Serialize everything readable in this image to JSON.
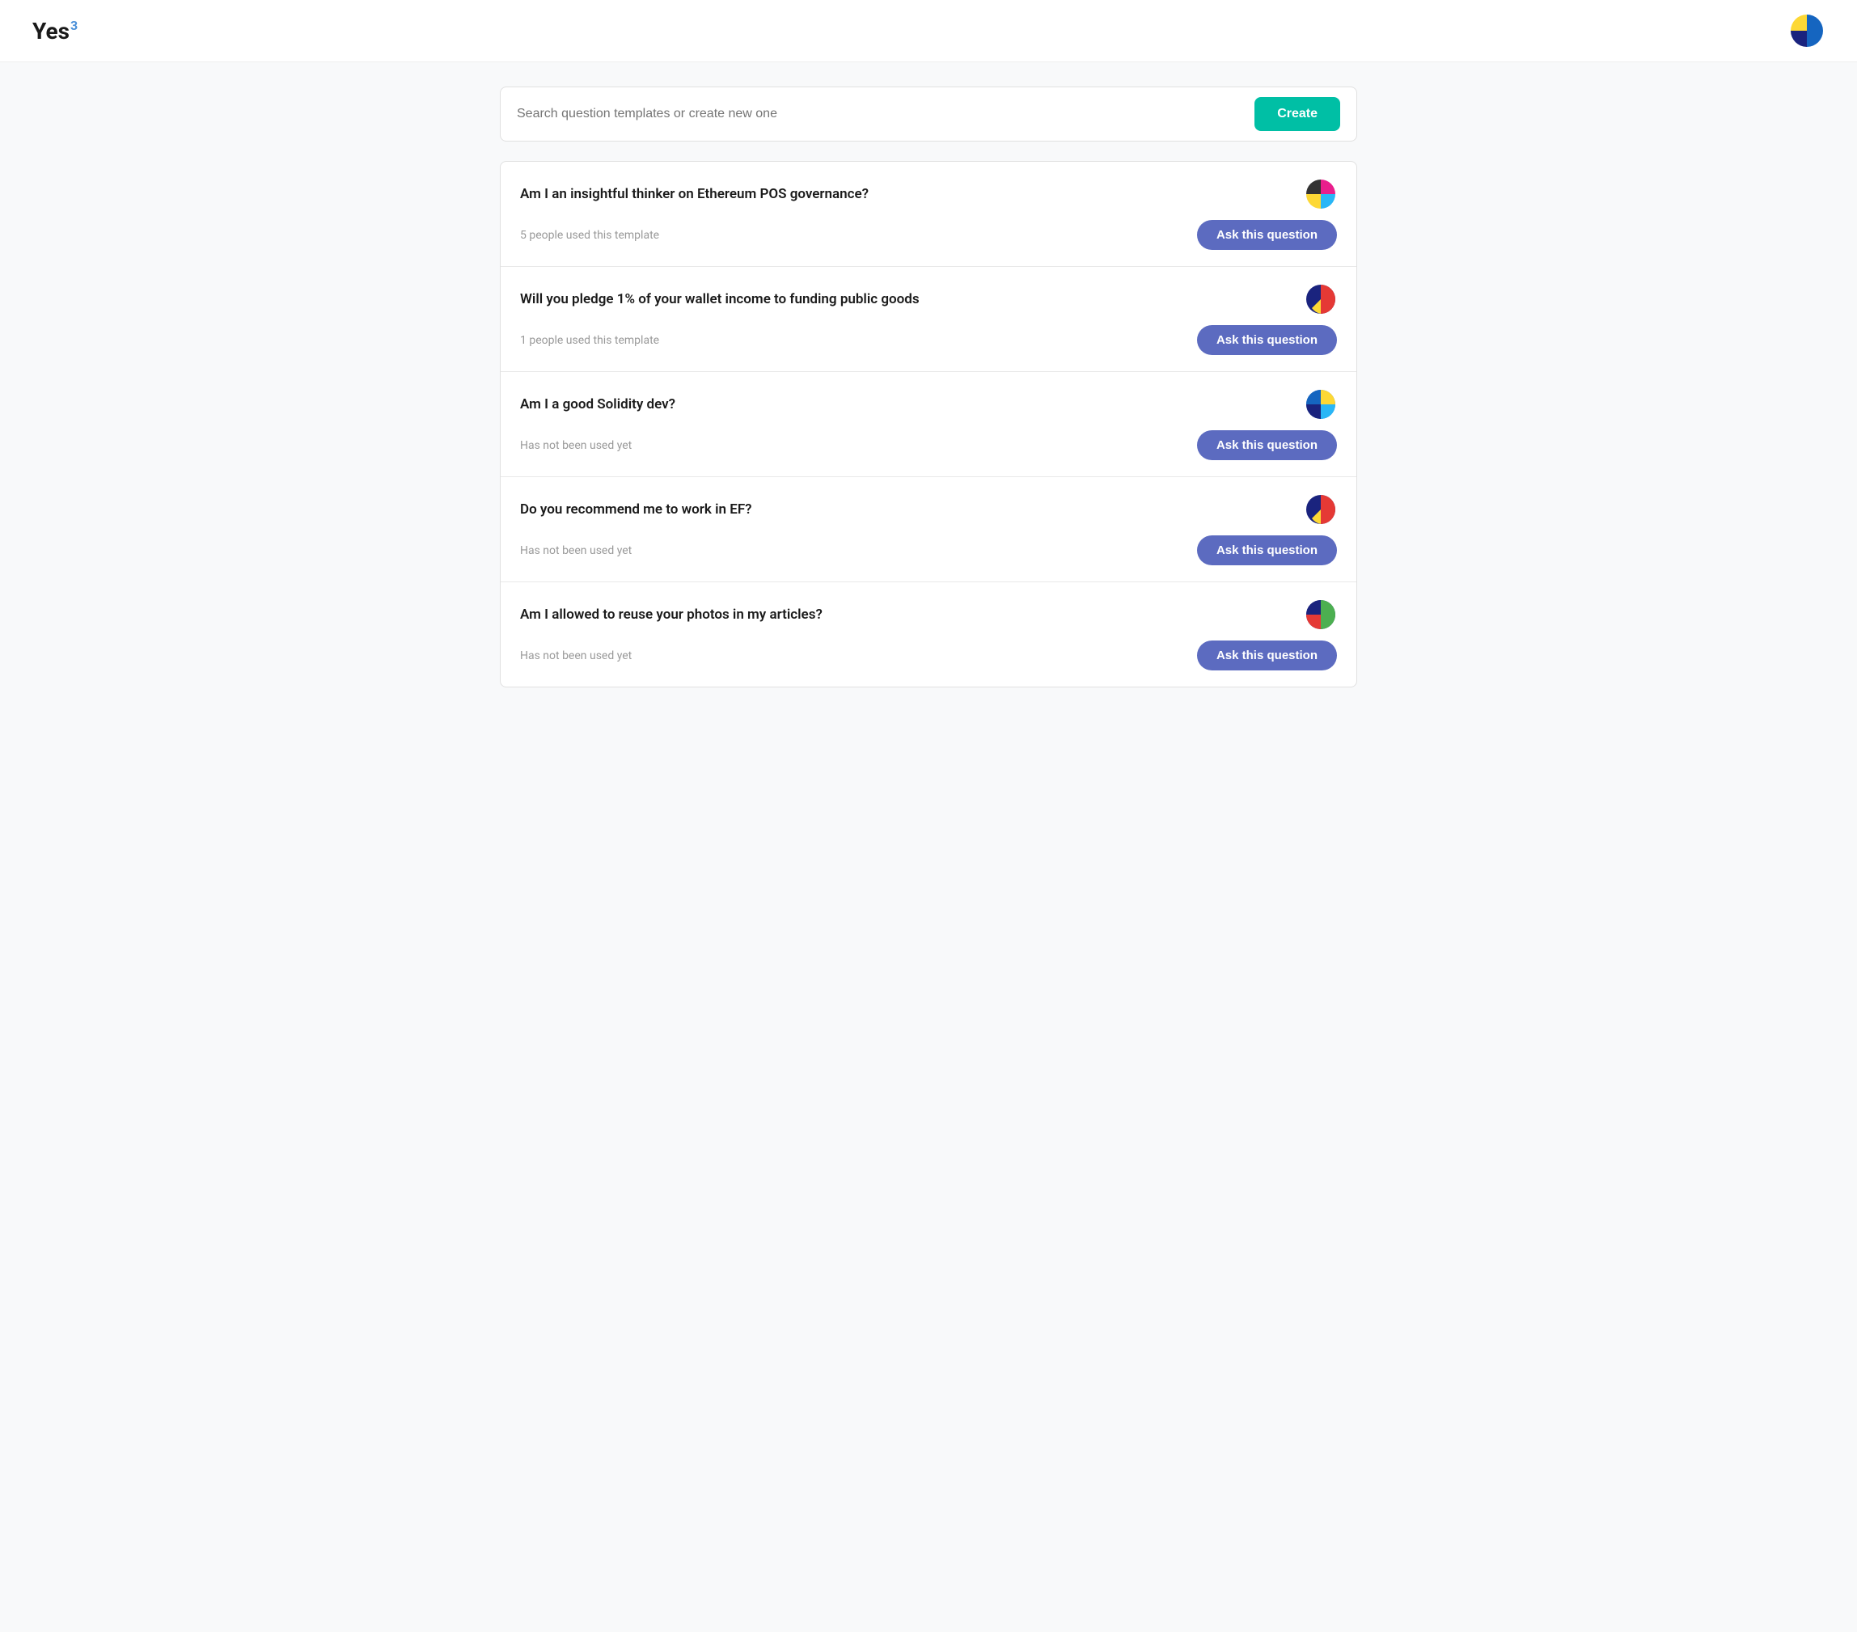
{
  "header": {
    "logo_text": "Yes",
    "logo_superscript": "3"
  },
  "search": {
    "placeholder": "Search question templates or create new one"
  },
  "create_button_label": "Create",
  "questions": [
    {
      "id": 1,
      "title": "Am I an insightful thinker on Ethereum POS governance?",
      "meta": "5 people used this template",
      "icon_colors": [
        "#e91e8c",
        "#29b6f6",
        "#fdd835"
      ],
      "ask_label": "Ask this question"
    },
    {
      "id": 2,
      "title": "Will you pledge 1% of your wallet income to funding public goods",
      "meta": "1 people used this template",
      "icon_colors": [
        "#1a237e",
        "#e53935",
        "#fdd835"
      ],
      "ask_label": "Ask this question"
    },
    {
      "id": 3,
      "title": "Am I a good Solidity dev?",
      "meta": "Has not been used yet",
      "icon_colors": [
        "#fdd835",
        "#29b6f6",
        "#1a237e"
      ],
      "ask_label": "Ask this question"
    },
    {
      "id": 4,
      "title": "Do you recommend me to work in EF?",
      "meta": "Has not been used yet",
      "icon_colors": [
        "#1a237e",
        "#e53935",
        "#fdd835"
      ],
      "ask_label": "Ask this question"
    },
    {
      "id": 5,
      "title": "Am I allowed to reuse your photos in my articles?",
      "meta": "Has not been used yet",
      "icon_colors": [
        "#1a237e",
        "#e53935",
        "#4caf50"
      ],
      "ask_label": "Ask this question"
    }
  ]
}
